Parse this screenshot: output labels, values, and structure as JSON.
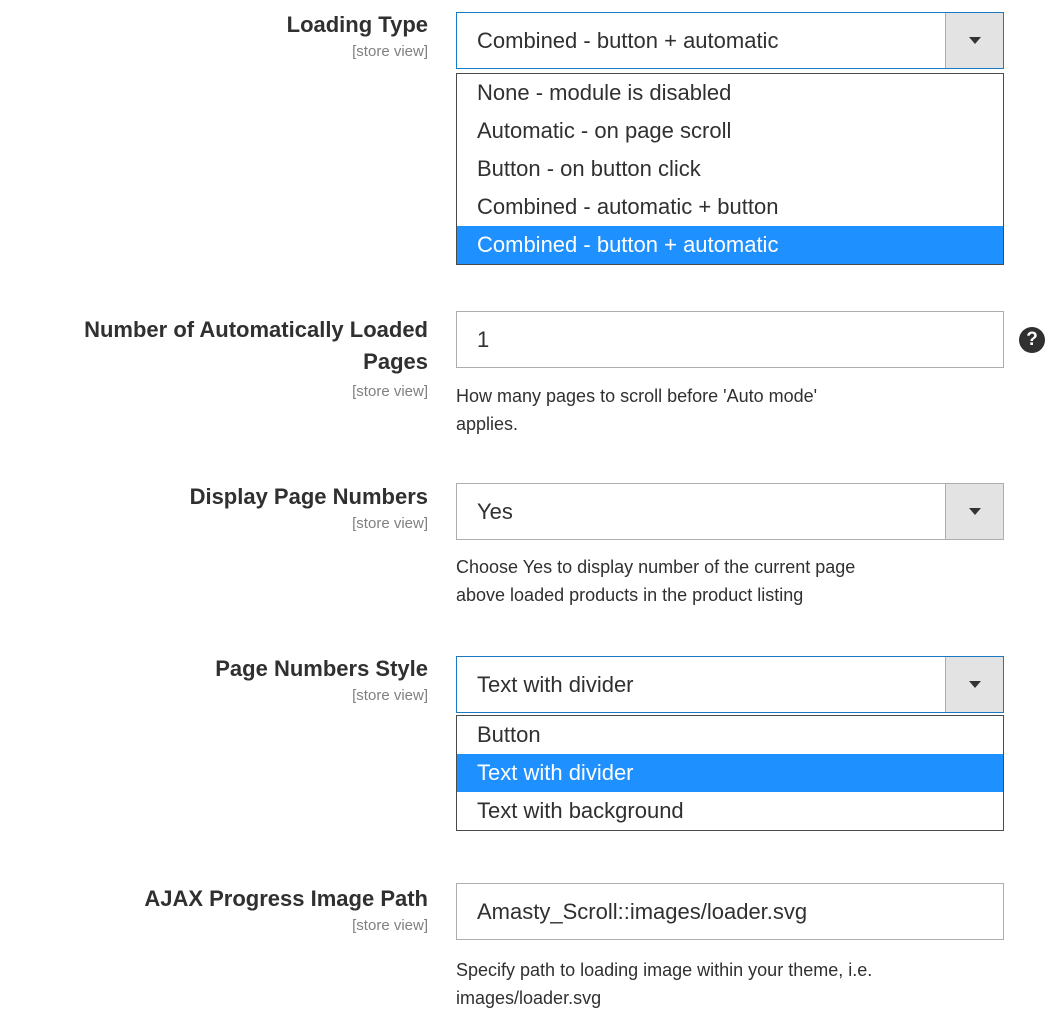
{
  "loading_type": {
    "label": "Loading Type",
    "scope": "[store view]",
    "selected": "Combined - button + automatic",
    "options": [
      "None - module is disabled",
      "Automatic - on page scroll",
      "Button - on button click",
      "Combined - automatic + button",
      "Combined - button + automatic"
    ],
    "highlighted_index": 4
  },
  "auto_pages": {
    "label_line1": "Number of Automatically Loaded",
    "label_line2": "Pages",
    "scope": "[store view]",
    "value": "1",
    "help_icon": "?",
    "note_line1": "How many pages to scroll before 'Auto mode'",
    "note_line2": "applies."
  },
  "display_page_numbers": {
    "label": "Display Page Numbers",
    "scope": "[store view]",
    "selected": "Yes",
    "note_line1": "Choose Yes to display number of the current page",
    "note_line2": "above loaded products in the product listing"
  },
  "page_numbers_style": {
    "label": "Page Numbers Style",
    "scope": "[store view]",
    "selected": "Text with divider",
    "options": [
      "Button",
      "Text with divider",
      "Text with background"
    ],
    "highlighted_index": 1
  },
  "ajax_image": {
    "label": "AJAX Progress Image Path",
    "scope": "[store view]",
    "value": "Amasty_Scroll::images/loader.svg",
    "note_line1": "Specify path to loading image within your theme, i.e.",
    "note_line2": "images/loader.svg"
  },
  "colors": {
    "highlight": "#1e90ff",
    "focus_border": "#1979c3"
  }
}
